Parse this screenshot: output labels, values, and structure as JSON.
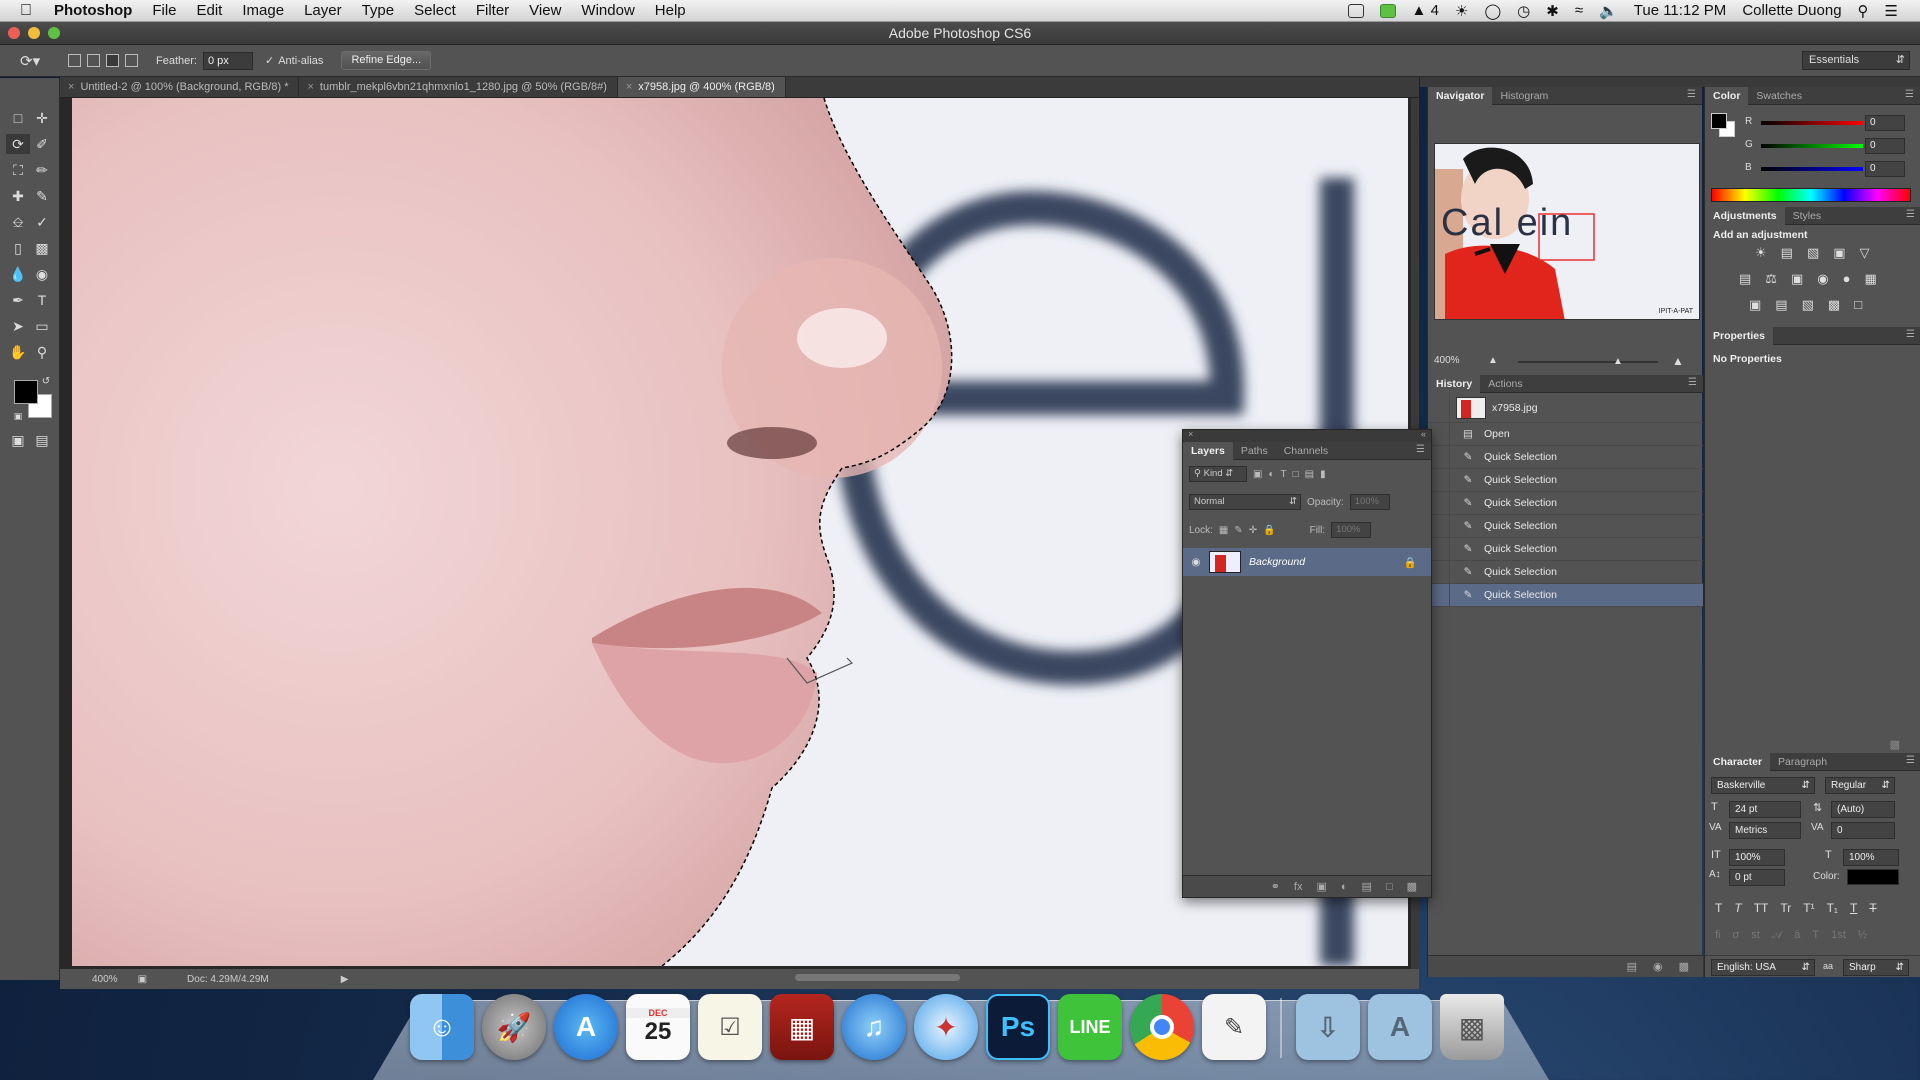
{
  "menubar": {
    "app_name": "Photoshop",
    "items": [
      "File",
      "Edit",
      "Image",
      "Layer",
      "Type",
      "Select",
      "Filter",
      "View",
      "Window",
      "Help"
    ],
    "status_number": "4",
    "clock": "Tue 11:12 PM",
    "user": "Collette Duong"
  },
  "window": {
    "title": "Adobe Photoshop CS6"
  },
  "options_bar": {
    "feather_label": "Feather:",
    "feather_value": "0 px",
    "antialias_label": "Anti-alias",
    "antialias_checked": true,
    "refine_button": "Refine Edge...",
    "workspace": "Essentials"
  },
  "doc_tabs": [
    {
      "label": "Untitled-2 @ 100% (Background, RGB/8) *",
      "active": false
    },
    {
      "label": "tumblr_mekpl6vbn21qhmxnlo1_1280.jpg @ 50% (RGB/8#)",
      "active": false
    },
    {
      "label": "x7958.jpg @ 400% (RGB/8)",
      "active": true
    }
  ],
  "canvas": {
    "zoom": "400%",
    "doc_info": "Doc: 4.29M/4.29M"
  },
  "navigator": {
    "tabs": [
      "Navigator",
      "Histogram"
    ],
    "zoom": "400%",
    "thumb_text": "Cal   ein",
    "watermark": "IPIT-A-PAT"
  },
  "history": {
    "tabs": [
      "History",
      "Actions"
    ],
    "snapshot": "x7958.jpg",
    "items": [
      "Open",
      "Quick Selection",
      "Quick Selection",
      "Quick Selection",
      "Quick Selection",
      "Quick Selection",
      "Quick Selection",
      "Quick Selection"
    ],
    "active_index": 7
  },
  "layers": {
    "tabs": [
      "Layers",
      "Paths",
      "Channels"
    ],
    "kind": "Kind",
    "blend_mode": "Normal",
    "opacity_label": "Opacity:",
    "opacity_value": "100%",
    "lock_label": "Lock:",
    "fill_label": "Fill:",
    "fill_value": "100%",
    "items": [
      {
        "name": "Background",
        "locked": true,
        "visible": true
      }
    ]
  },
  "color": {
    "tabs": [
      "Color",
      "Swatches"
    ],
    "r_label": "R",
    "r_value": "0",
    "g_label": "G",
    "g_value": "0",
    "b_label": "B",
    "b_value": "0"
  },
  "adjustments": {
    "tabs": [
      "Adjustments",
      "Styles"
    ],
    "heading": "Add an adjustment"
  },
  "properties": {
    "title": "Properties",
    "empty_text": "No Properties"
  },
  "character": {
    "tabs": [
      "Character",
      "Paragraph"
    ],
    "font_family": "Baskerville",
    "font_style": "Regular",
    "size": "24 pt",
    "leading": "(Auto)",
    "kerning": "Metrics",
    "tracking": "0",
    "vscale": "100%",
    "hscale": "100%",
    "baseline": "0 pt",
    "color_label": "Color:",
    "language": "English: USA",
    "antialias": "Sharp"
  },
  "dock": {
    "calendar_month": "DEC",
    "calendar_day": "25",
    "ps_label": "Ps",
    "line_label": "LINE"
  },
  "colors": {
    "ps_panel": "#535353",
    "selection_highlight": "#5b6a86",
    "history_active": "#5b6a86"
  }
}
